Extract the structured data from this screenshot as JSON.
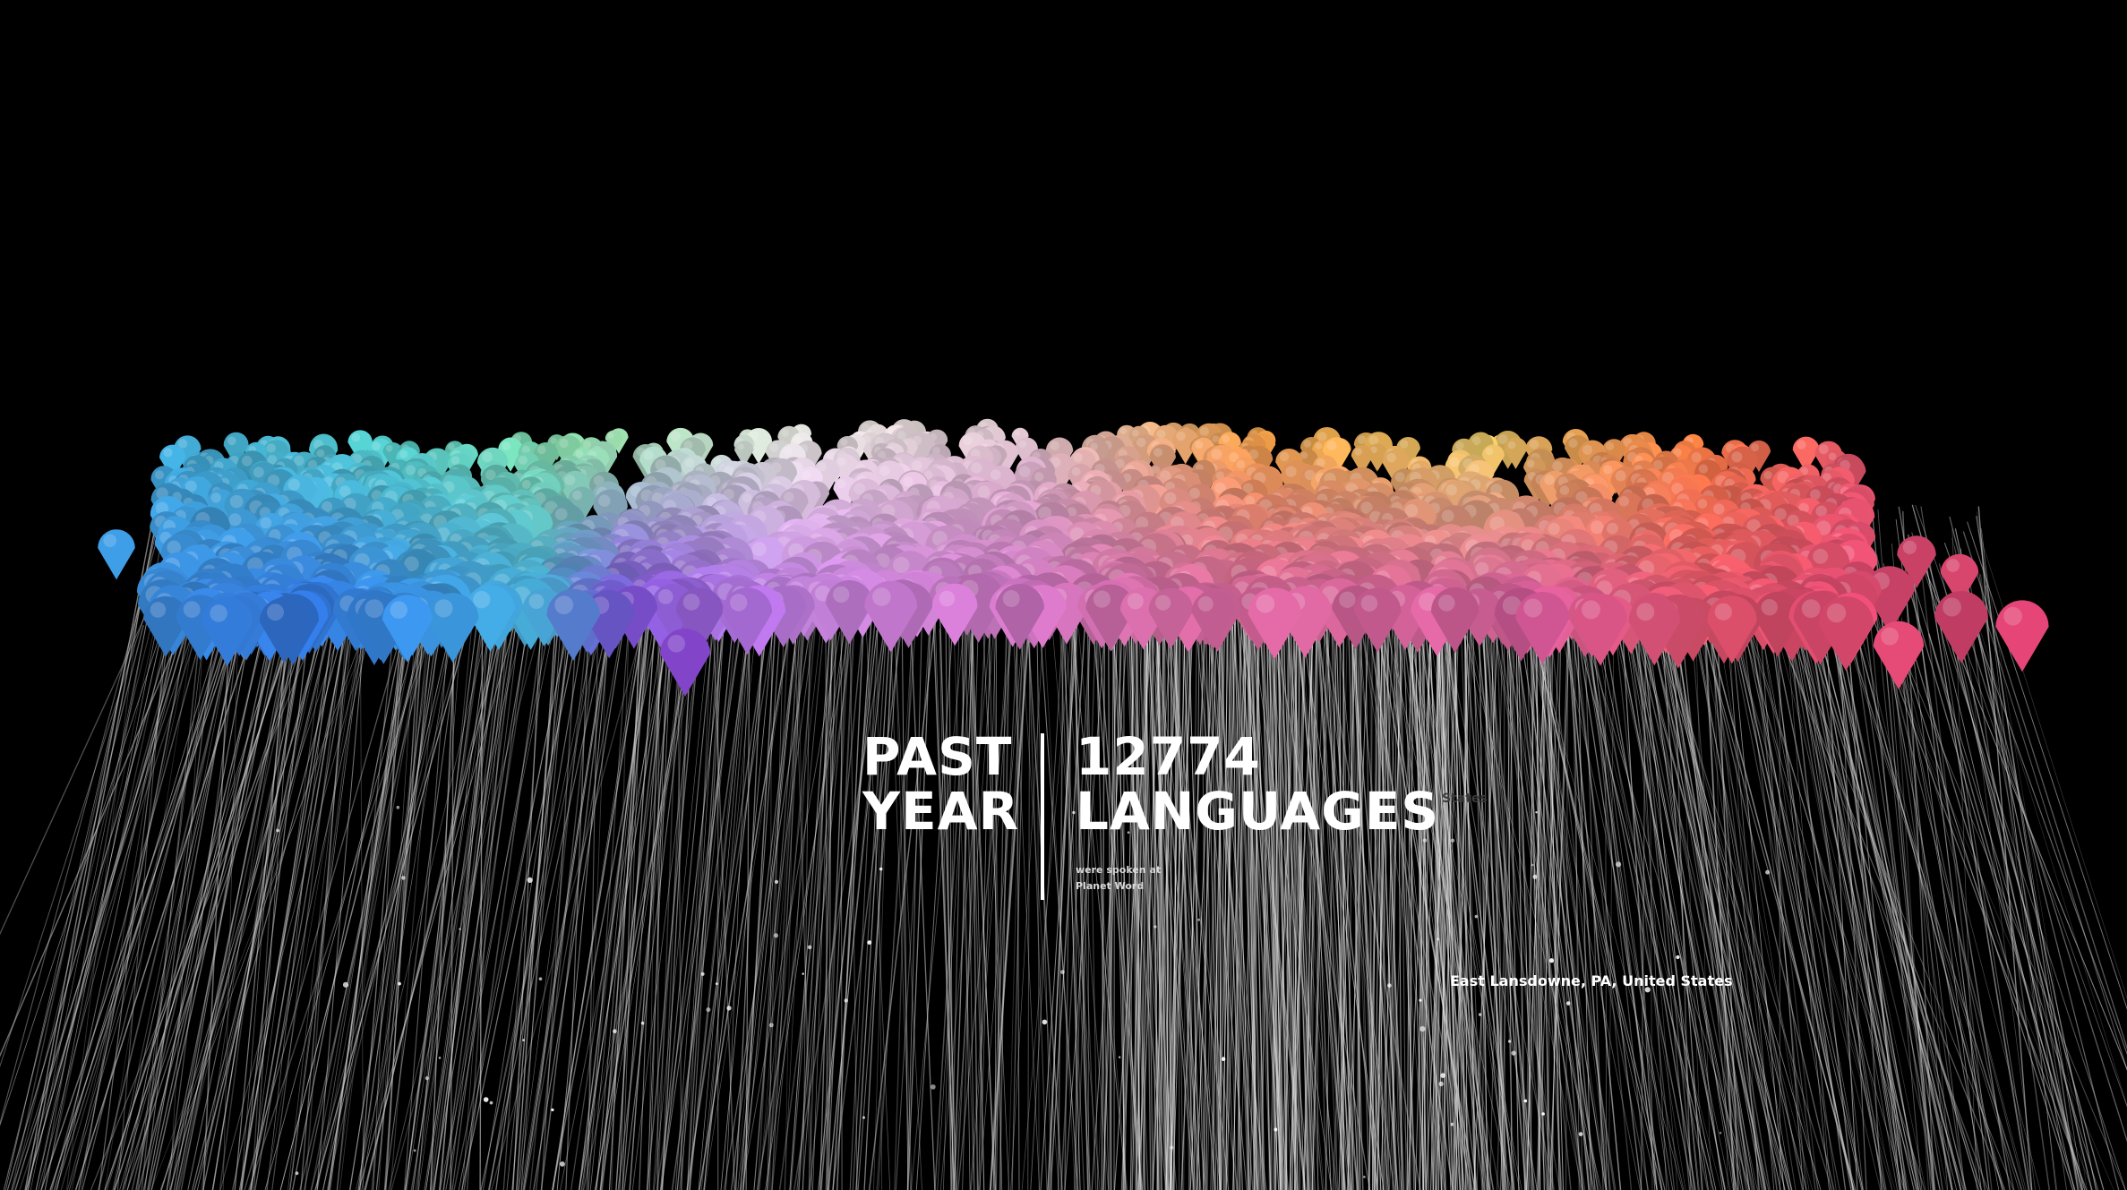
{
  "stat": {
    "period_line1": "PAST",
    "period_line2": "YEAR",
    "count_value": "12774",
    "count_unit": "LANGUAGES",
    "subtext_line1": "were spoken at",
    "subtext_line2": "Planet Word"
  },
  "location_label": "East Lansdowne, PA, United States",
  "ghost_label": "States",
  "colors": {
    "background": "#000000",
    "text": "#ffffff",
    "strand": "#cfcfcf",
    "palette": [
      "#2f6fe0",
      "#3aa0d8",
      "#56d0c0",
      "#8fe0a0",
      "#e8e8e0",
      "#7a3ce0",
      "#c070e0",
      "#d060a8",
      "#e05070",
      "#f07a3a",
      "#f0b030",
      "#e8d060"
    ]
  },
  "visualization": {
    "type": "language-drop-field",
    "marker_icon": "teardrop-pin-icon"
  }
}
